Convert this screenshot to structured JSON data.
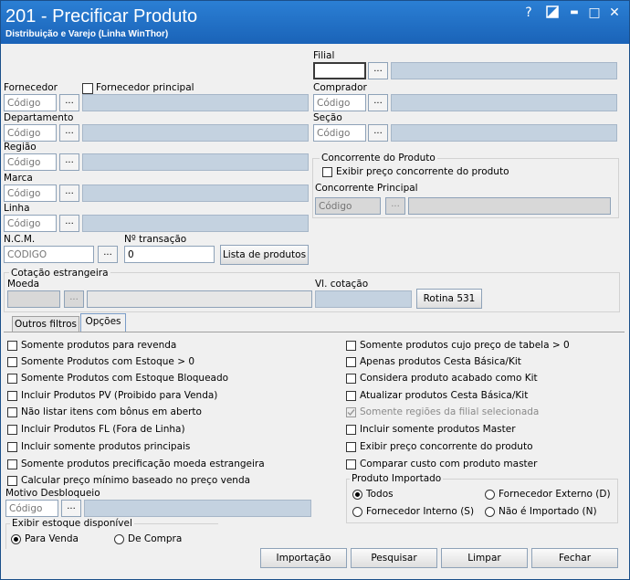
{
  "window": {
    "title": "201 - Precificar Produto",
    "subtitle": "Distribuição e Varejo (Linha WinThor)",
    "help_glyph": "?",
    "min_glyph": "▬",
    "max_glyph": "□",
    "close_glyph": "✕"
  },
  "common": {
    "dots": "...",
    "code_placeholder": "Código"
  },
  "filial": {
    "label": "Filial",
    "value": ""
  },
  "fornecedor": {
    "label": "Fornecedor",
    "principal_label": "Fornecedor principal"
  },
  "comprador": {
    "label": "Comprador"
  },
  "departamento": {
    "label": "Departamento"
  },
  "secao": {
    "label": "Seção"
  },
  "regiao": {
    "label": "Região"
  },
  "marca": {
    "label": "Marca"
  },
  "linha": {
    "label": "Linha"
  },
  "concorrente": {
    "group_label": "Concorrente do Produto",
    "exibir_label": "Exibir preço concorrente do produto",
    "principal_label": "Concorrente Principal"
  },
  "ncm": {
    "label": "N.C.M.",
    "placeholder": "CÓDIGO"
  },
  "transacao": {
    "label": "Nº transação",
    "value": "0"
  },
  "lista_produtos_button": "Lista de produtos",
  "cotacao": {
    "group_label": "Cotação estrangeira",
    "moeda_label": "Moeda",
    "vl_label": "Vl. cotação",
    "rotina_button": "Rotina 531"
  },
  "tabs": [
    {
      "label": "Outros filtros"
    },
    {
      "label": "Opções"
    }
  ],
  "options_left": [
    "Somente produtos para revenda",
    "Somente Produtos com Estoque > 0",
    "Somente Produtos com Estoque Bloqueado",
    "Incluir Produtos PV (Proibido para Venda)",
    "Não listar itens com bônus em aberto",
    "Incluir Produtos FL (Fora de Linha)",
    "Incluir somente produtos principais",
    "Somente produtos precificação moeda estrangeira",
    "Calcular preço mínimo baseado no preço venda"
  ],
  "options_right": [
    "Somente produtos cujo preço de tabela > 0",
    "Apenas produtos Cesta Básica/Kit",
    "Considera produto acabado como Kit",
    "Atualizar produtos Cesta Básica/Kit",
    "Somente regiões da filial selecionada",
    "Incluir somente produtos Master",
    "Exibir preço concorrente do produto",
    "Comparar custo com produto master"
  ],
  "motivo": {
    "label": "Motivo Desbloqueio"
  },
  "estoque": {
    "group_label": "Exibir estoque disponível",
    "para_venda": "Para Venda",
    "de_compra": "De Compra",
    "selected": "Para Venda"
  },
  "produto_importado": {
    "group_label": "Produto Importado",
    "todos": "Todos",
    "fornecedor_externo": "Fornecedor Externo (D)",
    "fornecedor_interno": "Fornecedor Interno (S)",
    "nao_importado": "Não é Importado (N)",
    "selected": "Todos"
  },
  "buttons": {
    "importacao": "Importação",
    "pesquisar": "Pesquisar",
    "limpar": "Limpar",
    "fechar": "Fechar"
  }
}
